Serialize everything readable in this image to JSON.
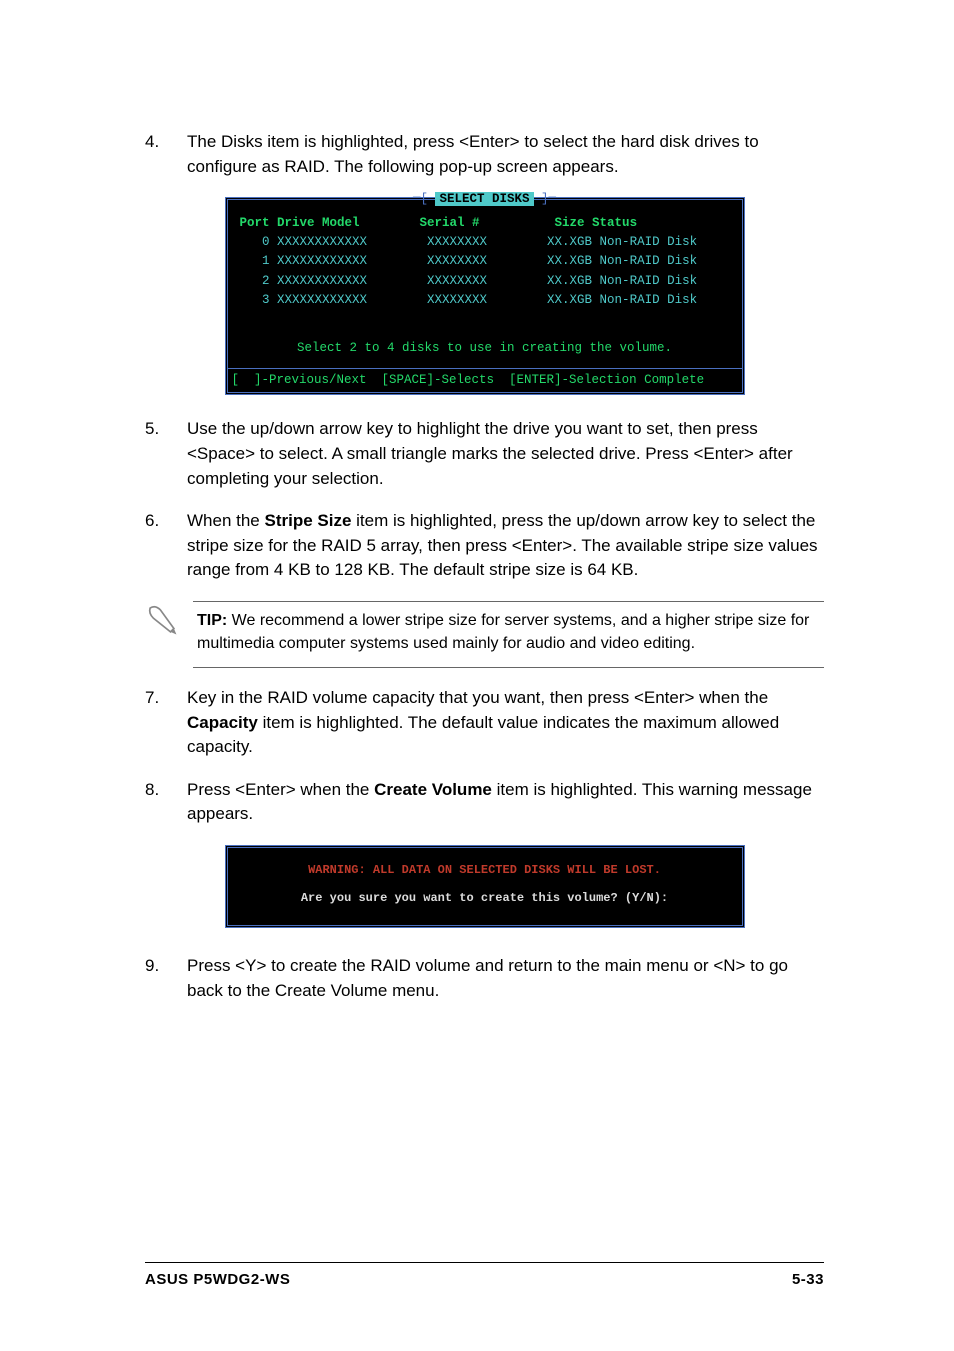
{
  "steps": {
    "s4": {
      "num": "4.",
      "text": "The Disks item is highlighted, press <Enter> to select the hard disk drives to configure as RAID. The following pop-up screen appears."
    },
    "s5": {
      "num": "5.",
      "text": "Use the up/down arrow key to highlight the drive you want to set, then press <Space> to select.  A small triangle marks the selected drive. Press <Enter> after completing your selection."
    },
    "s6": {
      "num": "6.",
      "pre": "When the ",
      "bold": "Stripe Size",
      "post": " item is highlighted, press the up/down arrow key to select the stripe size for the RAID 5 array, then press <Enter>. The available stripe size values range from 4 KB to 128 KB. The default stripe size is 64 KB."
    },
    "s7": {
      "num": "7.",
      "pre": "Key in the RAID volume capacity that you want, then press <Enter> when the ",
      "bold": "Capacity",
      "post": " item is highlighted. The default value indicates the maximum allowed capacity."
    },
    "s8": {
      "num": "8.",
      "pre": "Press <Enter> when the ",
      "bold": "Create Volume",
      "post": " item is highlighted. This warning message appears."
    },
    "s9": {
      "num": "9.",
      "text": "Press <Y> to create the RAID volume and return to the main menu or <N> to go back to the Create Volume menu."
    }
  },
  "bios": {
    "title": "SELECT DISKS",
    "header": "Port Drive Model        Serial #          Size Status",
    "rows": [
      "   0 XXXXXXXXXXXX        XXXXXXXX        XX.XGB Non-RAID Disk",
      "   1 XXXXXXXXXXXX        XXXXXXXX        XX.XGB Non-RAID Disk",
      "   2 XXXXXXXXXXXX        XXXXXXXX        XX.XGB Non-RAID Disk",
      "   3 XXXXXXXXXXXX        XXXXXXXX        XX.XGB Non-RAID Disk"
    ],
    "msg": "Select 2 to 4 disks to use in creating the volume.",
    "footer": "[  ]-Previous/Next  [SPACE]-Selects  [ENTER]-Selection Complete"
  },
  "tip": {
    "label": "TIP:",
    "text": " We recommend a lower stripe size for server systems, and a higher stripe size for multimedia computer systems used mainly for audio and video editing."
  },
  "warn": {
    "line1": "WARNING: ALL DATA ON SELECTED DISKS WILL BE LOST.",
    "line2": "Are you sure you want to create this volume? (Y/N):"
  },
  "footer": {
    "left": "ASUS P5WDG2-WS",
    "right": "5-33"
  }
}
